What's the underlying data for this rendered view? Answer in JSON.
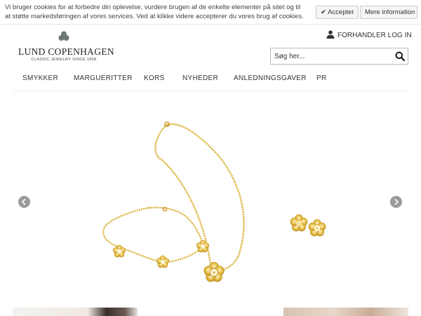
{
  "cookie_bar": {
    "message": "Vi bruger cookies for at forbedre din oplevelse, vurdere brugen af de enkelte elementer på sitet og til at støtte markedsføringen af vores services. Ved at klikke videre  accepterer du vores brug af cookies.",
    "accept_label": "✔ Accepter",
    "more_label": "Mere information"
  },
  "header": {
    "logo_name": "LUND COPENHAGEN",
    "logo_tagline": "CLASSIC JEWELRY SINCE 1858",
    "dealer_login_label": "FORHANDLER LOG IN",
    "search_placeholder": "Søg her..."
  },
  "nav": {
    "items": [
      "SMYKKER",
      "MARGUERITTER",
      "KORS",
      "NYHEDER",
      "ANLEDNINGSGAVER",
      "PR"
    ]
  },
  "colors": {
    "gold": "#d9b036",
    "gold_dark": "#b8891c",
    "arrow_bg": "#9a9a9a"
  }
}
